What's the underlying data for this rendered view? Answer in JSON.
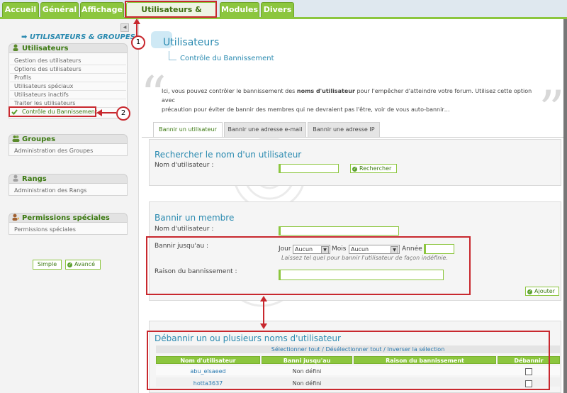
{
  "top_tabs": [
    "Accueil",
    "Général",
    "Affichage",
    "Utilisateurs & Groupes",
    "Modules",
    "Divers"
  ],
  "sidebar": {
    "heading": "➡ UTILISATEURS & GROUPES",
    "collapse_icon": "◀",
    "sections": [
      {
        "title": "Utilisateurs",
        "icon": "user-icon",
        "items": [
          "Gestion des utilisateurs",
          "Options des utilisateurs",
          "Profils",
          "Utilisateurs spéciaux",
          "Utilisateurs inactifs",
          "Traiter les utilisateurs",
          "Contrôle du Bannissement"
        ]
      },
      {
        "title": "Groupes",
        "icon": "group-icon",
        "items": [
          "Administration des Groupes"
        ]
      },
      {
        "title": "Rangs",
        "icon": "rank-icon",
        "items": [
          "Administration des Rangs"
        ]
      },
      {
        "title": "Permissions spéciales",
        "icon": "permission-icon",
        "items": [
          "Permissions spéciales"
        ]
      }
    ],
    "mode_simple": "Simple",
    "mode_advanced": "Avancé"
  },
  "page": {
    "title": "Utilisateurs",
    "subtitle": "Contrôle du Bannissement",
    "desc_prefix": "Ici, vous pouvez contrôler le bannissement des ",
    "desc_bold": "noms d'utilisateur",
    "desc_suffix": " pour l'empêcher d'atteindre votre forum. Utilisez cette option avec",
    "desc_line2": "précaution pour éviter de bannir des membres qui ne devraient pas l'être, voir de vous auto-bannir…"
  },
  "content_tabs": [
    "Bannir un utilisateur",
    "Bannir une adresse e-mail",
    "Bannir une adresse IP"
  ],
  "search": {
    "title": "Rechercher le nom d'un utilisateur",
    "label": "Nom d'utilisateur :",
    "button": "Rechercher"
  },
  "ban": {
    "title": "Bannir un membre",
    "username_label": "Nom d'utilisateur :",
    "until_label": "Bannir jusqu'au :",
    "day_label": "Jour",
    "day_value": "Aucun",
    "month_label": "Mois",
    "month_value": "Aucun",
    "year_label": "Année",
    "hint": "Laissez tel quel pour bannir l'utilisateur de façon indéfinie.",
    "reason_label": "Raison du bannissement :",
    "add_button": "Ajouter"
  },
  "unban": {
    "title": "Débannir un ou plusieurs noms d'utilisateur",
    "select_all": "Sélectionner tout",
    "sep1": " / ",
    "deselect_all": "Désélectionner tout",
    "sep2": " / ",
    "invert": "Inverser la sélection",
    "columns": [
      "Nom d'utilisateur",
      "Banni jusqu'au",
      "Raison du bannissement",
      "Débannir"
    ],
    "rows": [
      {
        "username": "abu_elsaeed",
        "until": "Non défini",
        "reason": ""
      },
      {
        "username": "hotta3637",
        "until": "Non défini",
        "reason": ""
      }
    ]
  },
  "annotations": {
    "callout_1": "1",
    "callout_2": "2"
  },
  "colors": {
    "accent_green": "#8cc63e",
    "title_blue": "#2a8ab0",
    "annotation_red": "#c8282e"
  }
}
